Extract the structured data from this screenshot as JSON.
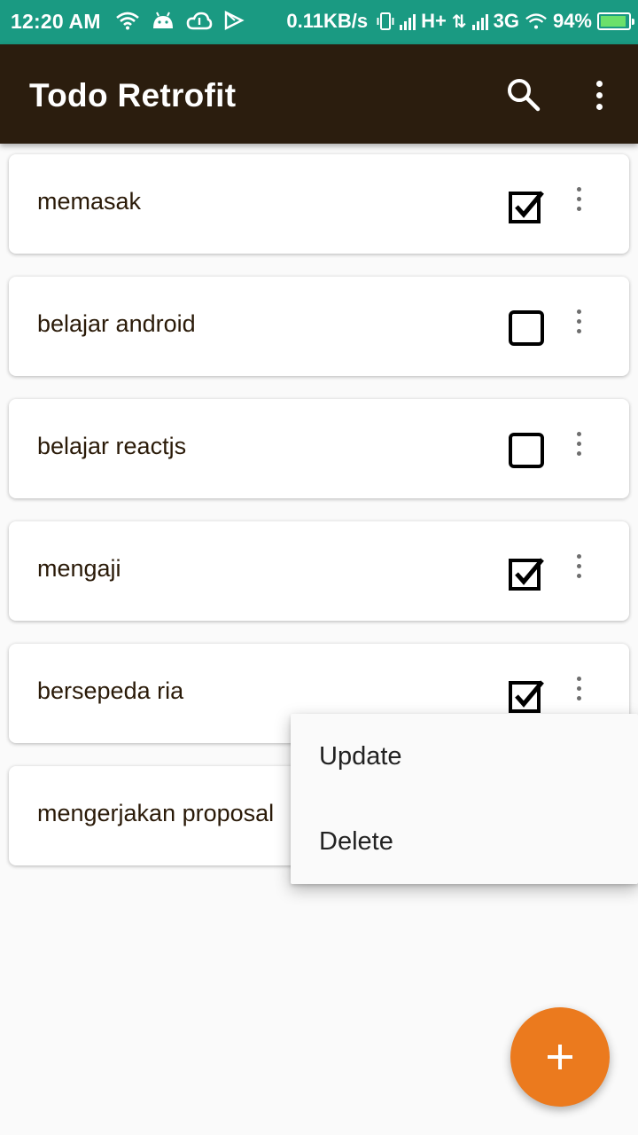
{
  "status_bar": {
    "time": "12:20 AM",
    "net_speed": "0.11KB/s",
    "network_h": "H+",
    "network_3g": "3G",
    "battery": "94%",
    "battery_level": 0.94
  },
  "app_bar": {
    "title": "Todo Retrofit",
    "search_icon": "search-icon",
    "more_icon": "more-vert-icon"
  },
  "todos": [
    {
      "title": "memasak",
      "checked": true
    },
    {
      "title": "belajar android",
      "checked": false
    },
    {
      "title": "belajar reactjs",
      "checked": false
    },
    {
      "title": "mengaji",
      "checked": true
    },
    {
      "title": "bersepeda ria",
      "checked": true
    },
    {
      "title": "mengerjakan proposal",
      "checked": null
    }
  ],
  "popup_menu": {
    "items": [
      "Update",
      "Delete"
    ]
  },
  "fab": {
    "icon": "add-icon",
    "color": "#eb7a1e"
  },
  "colors": {
    "status_bar": "#1a9a82",
    "app_bar": "#2b1d0e",
    "accent": "#eb7a1e"
  }
}
